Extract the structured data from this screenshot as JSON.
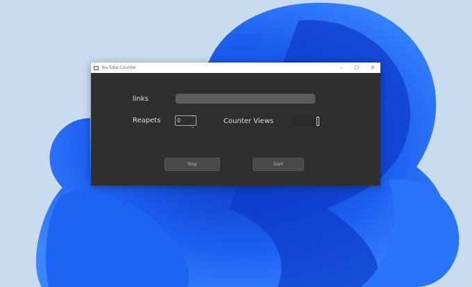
{
  "window": {
    "title": "YouTube Counter",
    "minimize": "–",
    "maximize": "☐",
    "close": "✕"
  },
  "form": {
    "links_label": "links",
    "links_value": "",
    "repeats_label": "Reapets",
    "repeats_value": "0",
    "counter_label": "Counter Views",
    "counter_value": ""
  },
  "buttons": {
    "stop": "Stop",
    "start": "Start"
  }
}
